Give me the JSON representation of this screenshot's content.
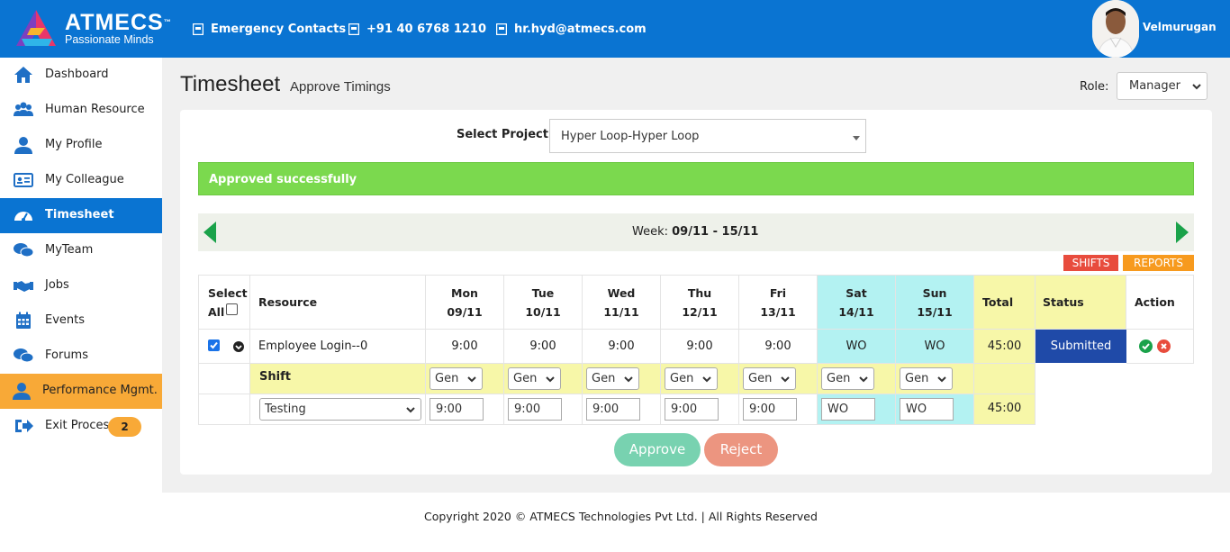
{
  "header": {
    "logo_text": "ATMECS",
    "logo_tm": "™",
    "logo_tagline": "Passionate Minds",
    "links": [
      {
        "label": "Emergency Contacts",
        "icon": "contact-card-icon"
      },
      {
        "label": "+91 40 6768 1210",
        "icon": "phone-card-icon"
      },
      {
        "label": "hr.hyd@atmecs.com",
        "icon": "email-card-icon"
      }
    ],
    "user_name": "Velmurugan"
  },
  "sidebar": {
    "items": [
      {
        "label": "Dashboard",
        "icon": "home-icon"
      },
      {
        "label": "Human Resource",
        "icon": "people-icon"
      },
      {
        "label": "My Profile",
        "icon": "user-icon"
      },
      {
        "label": "My Colleague",
        "icon": "id-card-icon"
      },
      {
        "label": "Timesheet",
        "icon": "speedometer-icon",
        "active": true
      },
      {
        "label": "MyTeam",
        "icon": "chat-icon"
      },
      {
        "label": "Jobs",
        "icon": "handshake-icon"
      },
      {
        "label": "Events",
        "icon": "calendar-icon"
      },
      {
        "label": "Forums",
        "icon": "comments-icon"
      },
      {
        "label": "Performance Mgmt.",
        "icon": "user-icon",
        "highlight": true
      },
      {
        "label": "Exit Process",
        "icon": "sign-out-icon",
        "badge": "2"
      }
    ]
  },
  "page": {
    "title": "Timesheet",
    "subtitle": "Approve Timings",
    "role_label": "Role:",
    "role_value": "Manager",
    "project_label": "Select Project",
    "project_value": "Hyper Loop-Hyper Loop",
    "alert": "Approved successfully",
    "week_prefix": "Week:",
    "week_range": "09/11 - 15/11",
    "shifts_button": "SHIFTS",
    "reports_button": "REPORTS"
  },
  "table": {
    "select_all_label": "Select",
    "select_all_label2": "All",
    "resource_header": "Resource",
    "days": [
      {
        "name": "Mon",
        "date": "09/11"
      },
      {
        "name": "Tue",
        "date": "10/11"
      },
      {
        "name": "Wed",
        "date": "11/11"
      },
      {
        "name": "Thu",
        "date": "12/11"
      },
      {
        "name": "Fri",
        "date": "13/11"
      },
      {
        "name": "Sat",
        "date": "14/11"
      },
      {
        "name": "Sun",
        "date": "15/11"
      }
    ],
    "total_header": "Total",
    "status_header": "Status",
    "action_header": "Action",
    "row": {
      "resource": "Employee Login--0",
      "hours": [
        "9:00",
        "9:00",
        "9:00",
        "9:00",
        "9:00",
        "WO",
        "WO"
      ],
      "total": "45:00",
      "status": "Submitted"
    },
    "shift_label": "Shift",
    "shifts": [
      "Gen",
      "Gen",
      "Gen",
      "Gen",
      "Gen",
      "Gen",
      "Gen"
    ],
    "task": "Testing",
    "task_hours": [
      "9:00",
      "9:00",
      "9:00",
      "9:00",
      "9:00",
      "WO",
      "WO"
    ],
    "task_total": "45:00"
  },
  "actions": {
    "approve": "Approve",
    "reject": "Reject"
  },
  "footer": {
    "copyright": "Copyright 2020 © ATMECS Technologies Pvt Ltd. | All Rights Reserved"
  },
  "colors": {
    "brand_blue": "#0a74d2",
    "sidebar_highlight": "#f8a937",
    "alert_green": "#7bd94e",
    "weekend_cyan": "#b3f2f2",
    "total_yellow": "#f7f7a8",
    "status_blue": "#1f4aa8"
  }
}
